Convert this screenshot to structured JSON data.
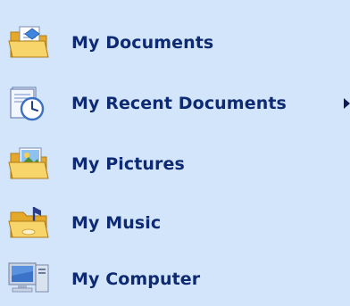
{
  "menu": {
    "items": [
      {
        "label": "My Documents",
        "icon": "my-documents-folder-icon",
        "has_submenu": false
      },
      {
        "label": "My Recent Documents",
        "icon": "recent-documents-clock-icon",
        "has_submenu": true
      },
      {
        "label": "My Pictures",
        "icon": "my-pictures-folder-icon",
        "has_submenu": false
      },
      {
        "label": "My Music",
        "icon": "my-music-folder-icon",
        "has_submenu": false
      },
      {
        "label": "My Computer",
        "icon": "my-computer-icon",
        "has_submenu": false
      }
    ]
  },
  "colors": {
    "background": "#d3e5fa",
    "text": "#0e2a73",
    "folder": "#f4c84e",
    "monitor": "#3a73c8"
  }
}
